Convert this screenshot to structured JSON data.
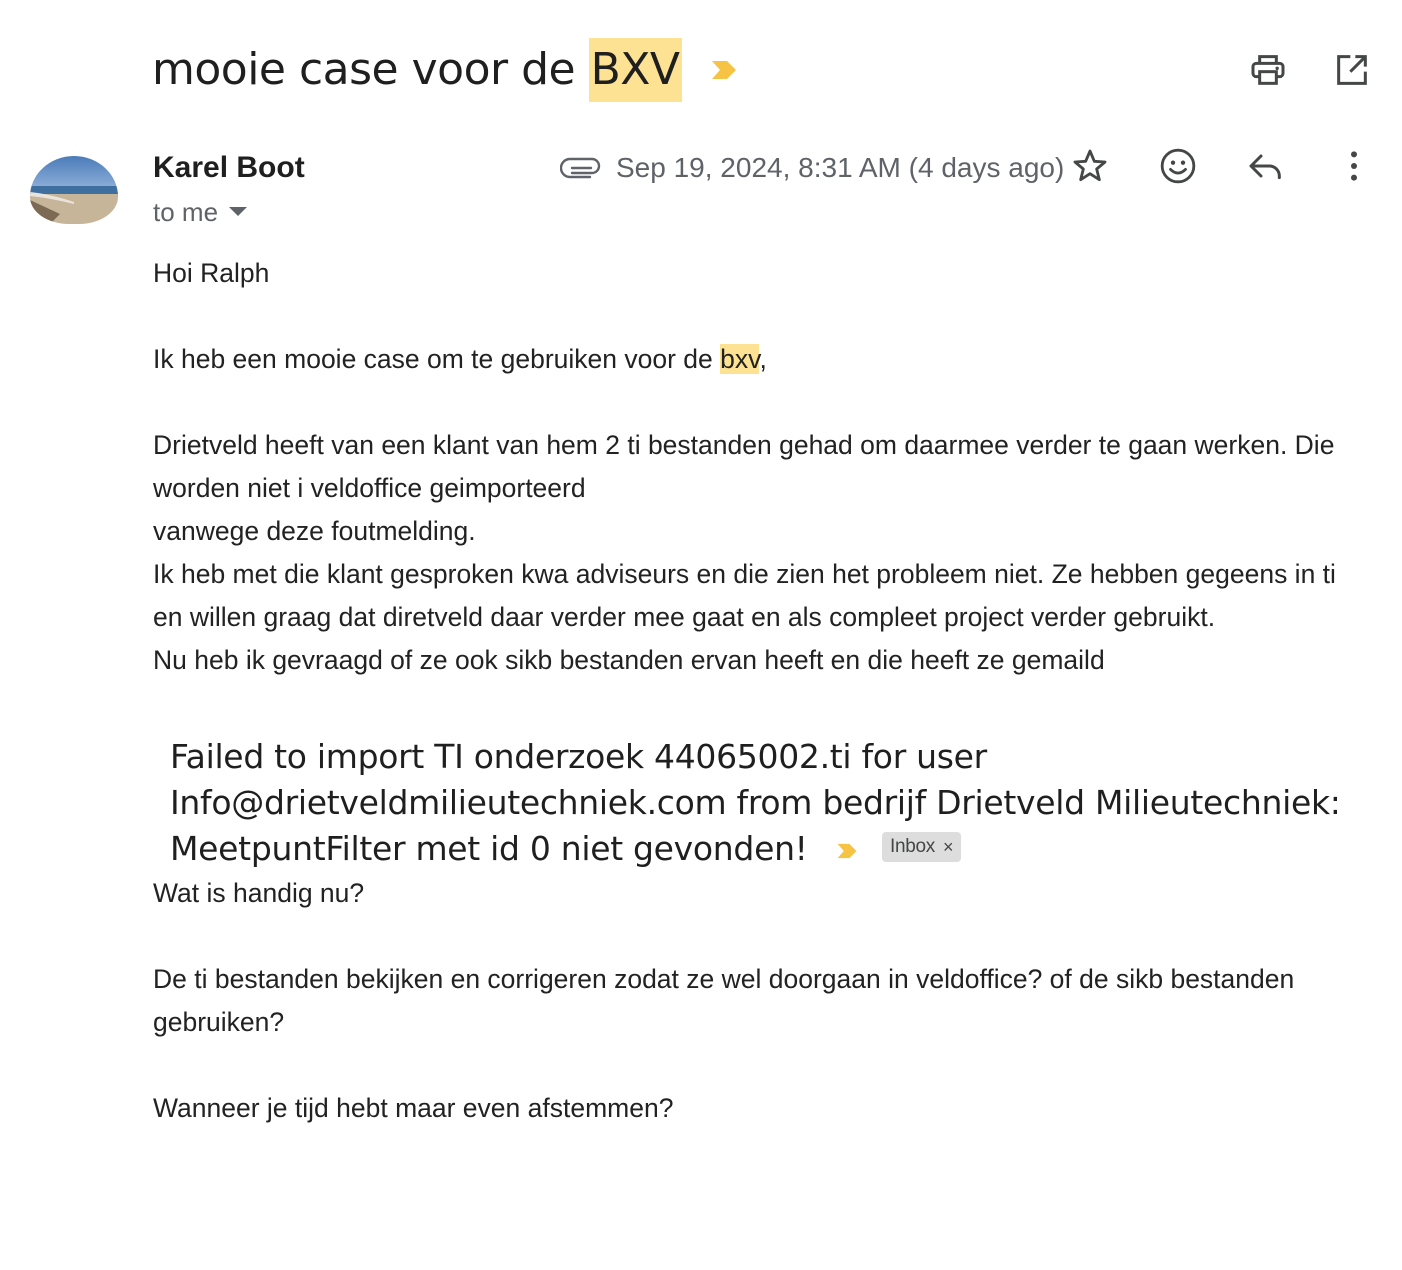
{
  "subject": {
    "prefix": "mooie case voor de ",
    "highlight": "BXV"
  },
  "icons": {
    "importance": "importance-marker-icon",
    "print": "print-icon",
    "open_new_window": "open-in-new-window-icon",
    "attachment": "paperclip-icon",
    "star": "star-icon",
    "emoji": "emoji-reaction-icon",
    "reply": "reply-icon",
    "more": "more-vertical-icon",
    "dropdown": "caret-down-icon",
    "chip_close": "close-icon"
  },
  "colors": {
    "highlight": "#fde293",
    "importance": "#f6c344",
    "secondary_text": "#5f6368",
    "chip_bg": "#dddddd"
  },
  "sender": {
    "name": "Karel Boot",
    "to": "to me"
  },
  "meta": {
    "date": "Sep 19, 2024, 8:31 AM (4 days ago)"
  },
  "body": {
    "greeting": "Hoi Ralph",
    "line1_prefix": "Ik heb een mooie case om te gebruiken voor de ",
    "line1_highlight": "bxv",
    "line1_suffix": ",",
    "para2_l1": "Drietveld heeft van een klant van hem 2 ti bestanden gehad om daarmee verder te gaan werken. Die worden niet i veldoffice geimporteerd",
    "para2_l2": "vanwege deze foutmelding.",
    "para2_l3": "Ik heb met die klant gesproken kwa adviseurs en die zien het probleem niet. Ze hebben gegeens in ti en willen graag dat diretveld daar verder mee gaat en als compleet project verder gebruikt.",
    "para2_l4": "Nu heb ik gevraagd of ze ook sikb bestanden ervan heeft en die heeft ze gemaild",
    "quote": "Failed to import TI onderzoek 44065002.ti for user Info@drietveldmilieutechniek.com from bedrijf Drietveld Milieutechniek: MeetpuntFilter met id 0 niet gevonden!",
    "quote_label": "Inbox",
    "question": "Wat is handig nu?",
    "options": "De ti bestanden bekijken en corrigeren zodat ze wel doorgaan in veldoffice? of de sikb bestanden gebruiken?",
    "closing": "Wanneer je tijd hebt maar even afstemmen?"
  }
}
